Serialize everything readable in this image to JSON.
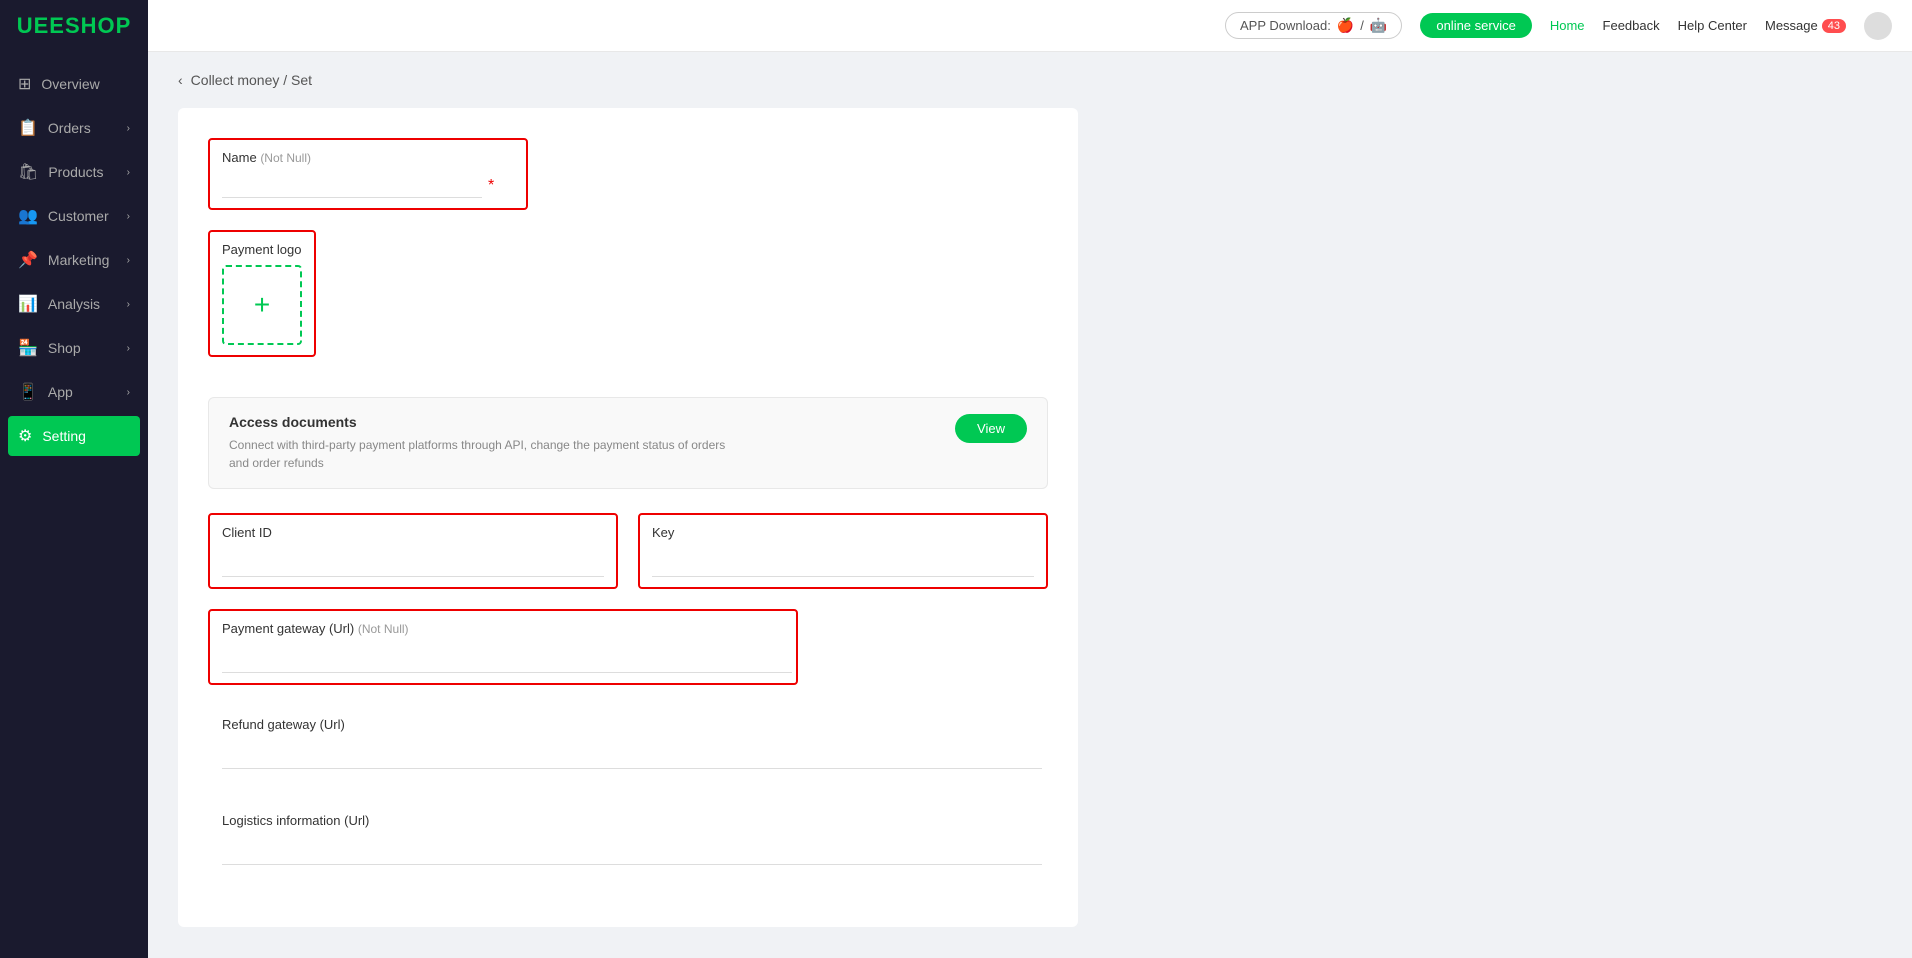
{
  "logo": "UEESHOP",
  "header": {
    "app_download_label": "APP Download:",
    "online_service_label": "online service",
    "home_label": "Home",
    "feedback_label": "Feedback",
    "help_center_label": "Help Center",
    "message_label": "Message",
    "message_count": "43"
  },
  "sidebar": {
    "items": [
      {
        "id": "overview",
        "label": "Overview",
        "icon": "⊞",
        "has_arrow": false
      },
      {
        "id": "orders",
        "label": "Orders",
        "icon": "📋",
        "has_arrow": true
      },
      {
        "id": "products",
        "label": "Products",
        "icon": "🛍",
        "has_arrow": true
      },
      {
        "id": "customer",
        "label": "Customer",
        "icon": "👥",
        "has_arrow": true
      },
      {
        "id": "marketing",
        "label": "Marketing",
        "icon": "📌",
        "has_arrow": true
      },
      {
        "id": "analysis",
        "label": "Analysis",
        "icon": "📊",
        "has_arrow": true
      },
      {
        "id": "shop",
        "label": "Shop",
        "icon": "🏪",
        "has_arrow": true
      },
      {
        "id": "app",
        "label": "App",
        "icon": "📱",
        "has_arrow": true
      },
      {
        "id": "setting",
        "label": "Setting",
        "icon": "⚙",
        "has_arrow": false
      }
    ]
  },
  "breadcrumb": {
    "back_icon": "‹",
    "text": "Collect money / Set"
  },
  "form": {
    "name_label": "Name",
    "name_not_null": "(Not Null)",
    "name_placeholder": "",
    "payment_logo_label": "Payment logo",
    "upload_plus": "+",
    "access_docs": {
      "title": "Access documents",
      "description": "Connect with third-party payment platforms through API, change the payment status of orders and order refunds",
      "view_btn": "View"
    },
    "client_id_label": "Client ID",
    "client_id_placeholder": "",
    "key_label": "Key",
    "key_placeholder": "",
    "payment_gateway_label": "Payment gateway (Url)",
    "payment_gateway_not_null": "(Not Null)",
    "payment_gateway_placeholder": "",
    "refund_gateway_label": "Refund gateway (Url)",
    "refund_gateway_placeholder": "",
    "logistics_label": "Logistics information (Url)",
    "logistics_placeholder": ""
  }
}
